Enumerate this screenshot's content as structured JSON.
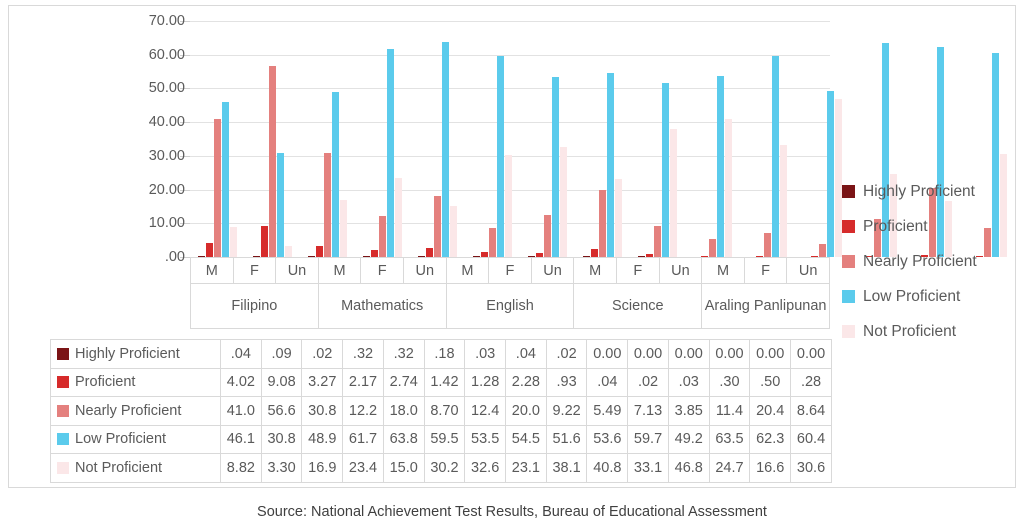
{
  "caption": "Source: National Achievement Test Results, Bureau of Educational Assessment",
  "colors": {
    "highly_proficient": "#7b1416",
    "proficient": "#d62b2b",
    "nearly_proficient": "#e4807e",
    "low_proficient": "#5bcbec",
    "not_proficient": "#fbe7e8",
    "gridline": "#e2e2e2",
    "border": "#d9d9d9",
    "text": "#5a5a5a"
  },
  "legend": {
    "position": "right",
    "items": [
      {
        "label": "Highly Proficient",
        "color": "#7b1416"
      },
      {
        "label": "Proficient",
        "color": "#d62b2b"
      },
      {
        "label": "Nearly Proficient",
        "color": "#e4807e"
      },
      {
        "label": "Low Proficient",
        "color": "#5bcbec"
      },
      {
        "label": "Not Proficient",
        "color": "#fbe7e8"
      }
    ]
  },
  "yaxis": {
    "ticks": [
      "70.00",
      "60.00",
      "50.00",
      "40.00",
      "30.00",
      "20.00",
      "10.00",
      ".00"
    ],
    "min": 0,
    "max": 70
  },
  "xaxis": {
    "groups": [
      {
        "subject": "Filipino",
        "sexes": [
          "M",
          "F",
          "Un"
        ]
      },
      {
        "subject": "Mathematics",
        "sexes": [
          "M",
          "F",
          "Un"
        ]
      },
      {
        "subject": "English",
        "sexes": [
          "M",
          "F",
          "Un"
        ]
      },
      {
        "subject": "Science",
        "sexes": [
          "M",
          "F",
          "Un"
        ]
      },
      {
        "subject": "Araling Panlipunan",
        "sexes": [
          "M",
          "F",
          "Un"
        ]
      }
    ]
  },
  "table": {
    "rows": [
      {
        "label": "Highly Proficient",
        "color": "#7b1416",
        "values": [
          ".04",
          ".09",
          ".02",
          ".32",
          ".32",
          ".18",
          ".03",
          ".04",
          ".02",
          "0.00",
          "0.00",
          "0.00",
          "0.00",
          "0.00",
          "0.00"
        ]
      },
      {
        "label": "Proficient",
        "color": "#d62b2b",
        "values": [
          "4.02",
          "9.08",
          "3.27",
          "2.17",
          "2.74",
          "1.42",
          "1.28",
          "2.28",
          ".93",
          ".04",
          ".02",
          ".03",
          ".30",
          ".50",
          ".28"
        ]
      },
      {
        "label": "Nearly Proficient",
        "color": "#e4807e",
        "values": [
          "41.0",
          "56.6",
          "30.8",
          "12.2",
          "18.0",
          "8.70",
          "12.4",
          "20.0",
          "9.22",
          "5.49",
          "7.13",
          "3.85",
          "11.4",
          "20.4",
          "8.64"
        ]
      },
      {
        "label": "Low Proficient",
        "color": "#5bcbec",
        "values": [
          "46.1",
          "30.8",
          "48.9",
          "61.7",
          "63.8",
          "59.5",
          "53.5",
          "54.5",
          "51.6",
          "53.6",
          "59.7",
          "49.2",
          "63.5",
          "62.3",
          "60.4"
        ]
      },
      {
        "label": "Not Proficient",
        "color": "#fbe7e8",
        "values": [
          "8.82",
          "3.30",
          "16.9",
          "23.4",
          "15.0",
          "30.2",
          "32.6",
          "23.1",
          "38.1",
          "40.8",
          "33.1",
          "46.8",
          "24.7",
          "16.6",
          "30.6"
        ]
      }
    ]
  },
  "chart_data": {
    "type": "bar",
    "title": "",
    "xlabel": "",
    "ylabel": "",
    "ylim": [
      0,
      70
    ],
    "grid": true,
    "categories": [
      "Filipino M",
      "Filipino F",
      "Filipino Un",
      "Mathematics M",
      "Mathematics F",
      "Mathematics Un",
      "English M",
      "English F",
      "English Un",
      "Science M",
      "Science F",
      "Science Un",
      "Araling Panlipunan M",
      "Araling Panlipunan F",
      "Araling Panlipunan Un"
    ],
    "series": [
      {
        "name": "Highly Proficient",
        "color": "#7b1416",
        "values": [
          0.04,
          0.09,
          0.02,
          0.32,
          0.32,
          0.18,
          0.03,
          0.04,
          0.02,
          0.0,
          0.0,
          0.0,
          0.0,
          0.0,
          0.0
        ]
      },
      {
        "name": "Proficient",
        "color": "#d62b2b",
        "values": [
          4.02,
          9.08,
          3.27,
          2.17,
          2.74,
          1.42,
          1.28,
          2.28,
          0.93,
          0.04,
          0.02,
          0.03,
          0.3,
          0.5,
          0.28
        ]
      },
      {
        "name": "Nearly Proficient",
        "color": "#e4807e",
        "values": [
          41.0,
          56.6,
          30.8,
          12.2,
          18.0,
          8.7,
          12.4,
          20.0,
          9.22,
          5.49,
          7.13,
          3.85,
          11.4,
          20.4,
          8.64
        ]
      },
      {
        "name": "Low Proficient",
        "color": "#5bcbec",
        "values": [
          46.1,
          30.8,
          48.9,
          61.7,
          63.8,
          59.5,
          53.5,
          54.5,
          51.6,
          53.6,
          59.7,
          49.2,
          63.5,
          62.3,
          60.4
        ]
      },
      {
        "name": "Not Proficient",
        "color": "#fbe7e8",
        "values": [
          8.82,
          3.3,
          16.9,
          23.4,
          15.0,
          30.2,
          32.6,
          23.1,
          38.1,
          40.8,
          33.1,
          46.8,
          24.7,
          16.6,
          30.6
        ]
      }
    ]
  }
}
